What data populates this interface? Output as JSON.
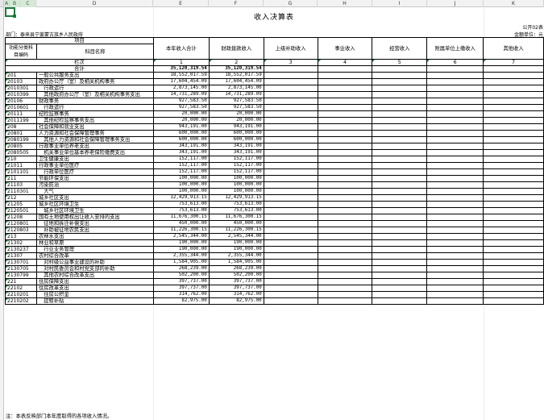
{
  "columns": [
    "A",
    "B",
    "C",
    "D",
    "E",
    "F",
    "G",
    "H",
    "I",
    "J",
    "K"
  ],
  "title": "收入决算表",
  "form_no": "公开02表",
  "department": "部门：泰来县宁姜蒙古族乡人民政府",
  "unit": "金额单位：元",
  "header": {
    "project": "项目",
    "func_code": "功能分类科目编码",
    "subject_name": "科目名称",
    "total_income": "本年收入合计",
    "fiscal": "财政拨款收入",
    "superior": "上级补助收入",
    "business": "事业收入",
    "operation": "经营收入",
    "affiliated": "附属单位上缴收入",
    "other": "其他收入",
    "column_label": "栏次",
    "col_nums": [
      "1",
      "2",
      "3",
      "4",
      "5",
      "6",
      "7"
    ],
    "total_label": "合计",
    "total_income_value": "35,120,319.54",
    "total_fiscal_value": "35,120,319.54"
  },
  "rows": [
    {
      "code": "201",
      "name": "一般公共服务支出",
      "total": "18,552,017.59",
      "fiscal": "18,552,017.59"
    },
    {
      "code": "20103",
      "name": "政府办公厅（室）及相关机构事务",
      "total": "17,604,454.09",
      "fiscal": "17,604,454.09"
    },
    {
      "code": "2010301",
      "name": "　行政运行",
      "total": "2,873,145.00",
      "fiscal": "2,873,145.00"
    },
    {
      "code": "2010399",
      "name": "　其他政府办公厅（室）及相关机构事务支出",
      "total": "14,731,289.09",
      "fiscal": "14,731,289.09"
    },
    {
      "code": "20106",
      "name": "财政事务",
      "total": "927,583.50",
      "fiscal": "927,583.50"
    },
    {
      "code": "2010601",
      "name": "　行政运行",
      "total": "927,583.50",
      "fiscal": "927,583.50"
    },
    {
      "code": "20111",
      "name": "纪检监察事务",
      "total": "20,000.00",
      "fiscal": "20,000.00"
    },
    {
      "code": "2011199",
      "name": "　其他纪检监察事务支出",
      "total": "20,000.00",
      "fiscal": "20,000.00"
    },
    {
      "code": "208",
      "name": "社会保障和就业支出",
      "total": "943,191.00",
      "fiscal": "943,191.00"
    },
    {
      "code": "20801",
      "name": "人力资源和社会保障管理事务",
      "total": "600,000.00",
      "fiscal": "600,000.00"
    },
    {
      "code": "2080199",
      "name": "　其他人力资源和社会保障管理事务支出",
      "total": "600,000.00",
      "fiscal": "600,000.00"
    },
    {
      "code": "20805",
      "name": "行政事业单位养老支出",
      "total": "343,191.00",
      "fiscal": "343,191.00"
    },
    {
      "code": "2080505",
      "name": "　机关事业单位基本养老保险缴费支出",
      "total": "343,191.00",
      "fiscal": "343,191.00"
    },
    {
      "code": "210",
      "name": "卫生健康支出",
      "total": "152,117.00",
      "fiscal": "152,117.00"
    },
    {
      "code": "21011",
      "name": "行政事业单位医疗",
      "total": "152,117.00",
      "fiscal": "152,117.00"
    },
    {
      "code": "2101101",
      "name": "　行政单位医疗",
      "total": "152,117.00",
      "fiscal": "152,117.00"
    },
    {
      "code": "211",
      "name": "节能环保支出",
      "total": "100,000.00",
      "fiscal": "100,000.00"
    },
    {
      "code": "21103",
      "name": "污染防治",
      "total": "100,000.00",
      "fiscal": "100,000.00"
    },
    {
      "code": "2110301",
      "name": "　大气",
      "total": "100,000.00",
      "fiscal": "100,000.00"
    },
    {
      "code": "212",
      "name": "城乡社区支出",
      "total": "12,429,913.15",
      "fiscal": "12,429,913.15"
    },
    {
      "code": "21205",
      "name": "城乡社区环境卫生",
      "total": "753,613.00",
      "fiscal": "753,613.00"
    },
    {
      "code": "2120501",
      "name": "　城乡社区环境卫生",
      "total": "753,613.00",
      "fiscal": "753,613.00"
    },
    {
      "code": "21208",
      "name": "国有土地使用权出让收入安排的支出",
      "total": "11,676,300.15",
      "fiscal": "11,676,300.15"
    },
    {
      "code": "2120801",
      "name": "　征地和拆迁补偿支出",
      "total": "450,000.00",
      "fiscal": "450,000.00"
    },
    {
      "code": "2120803",
      "name": "　补助被征地农民支出",
      "total": "11,226,300.15",
      "fiscal": "11,226,300.15"
    },
    {
      "code": "213",
      "name": "农林水支出",
      "total": "2,545,344.00",
      "fiscal": "2,545,344.00"
    },
    {
      "code": "21302",
      "name": "林业和草原",
      "total": "190,000.00",
      "fiscal": "190,000.00"
    },
    {
      "code": "2130237",
      "name": "　行业业务管理",
      "total": "190,000.00",
      "fiscal": "190,000.00"
    },
    {
      "code": "21307",
      "name": "农村综合改革",
      "total": "2,355,344.00",
      "fiscal": "2,355,344.00"
    },
    {
      "code": "2130701",
      "name": "　对村级公益事业建设的补助",
      "total": "1,584,905.00",
      "fiscal": "1,584,905.00"
    },
    {
      "code": "2130705",
      "name": "　对村民委员会和村党支部的补助",
      "total": "268,239.00",
      "fiscal": "268,239.00"
    },
    {
      "code": "2130799",
      "name": "　其他农村综合改革支出",
      "total": "502,200.00",
      "fiscal": "502,200.00"
    },
    {
      "code": "221",
      "name": "住房保障支出",
      "total": "397,737.00",
      "fiscal": "397,737.00"
    },
    {
      "code": "22102",
      "name": "住房改革支出",
      "total": "397,737.00",
      "fiscal": "397,737.00"
    },
    {
      "code": "2210201",
      "name": "　住房公积金",
      "total": "314,762.00",
      "fiscal": "314,762.00"
    },
    {
      "code": "2210202",
      "name": "　提租补贴",
      "total": "82,975.00",
      "fiscal": "82,975.00"
    }
  ],
  "note": "注：本表反映部门本年度取得的各项收入情况。"
}
